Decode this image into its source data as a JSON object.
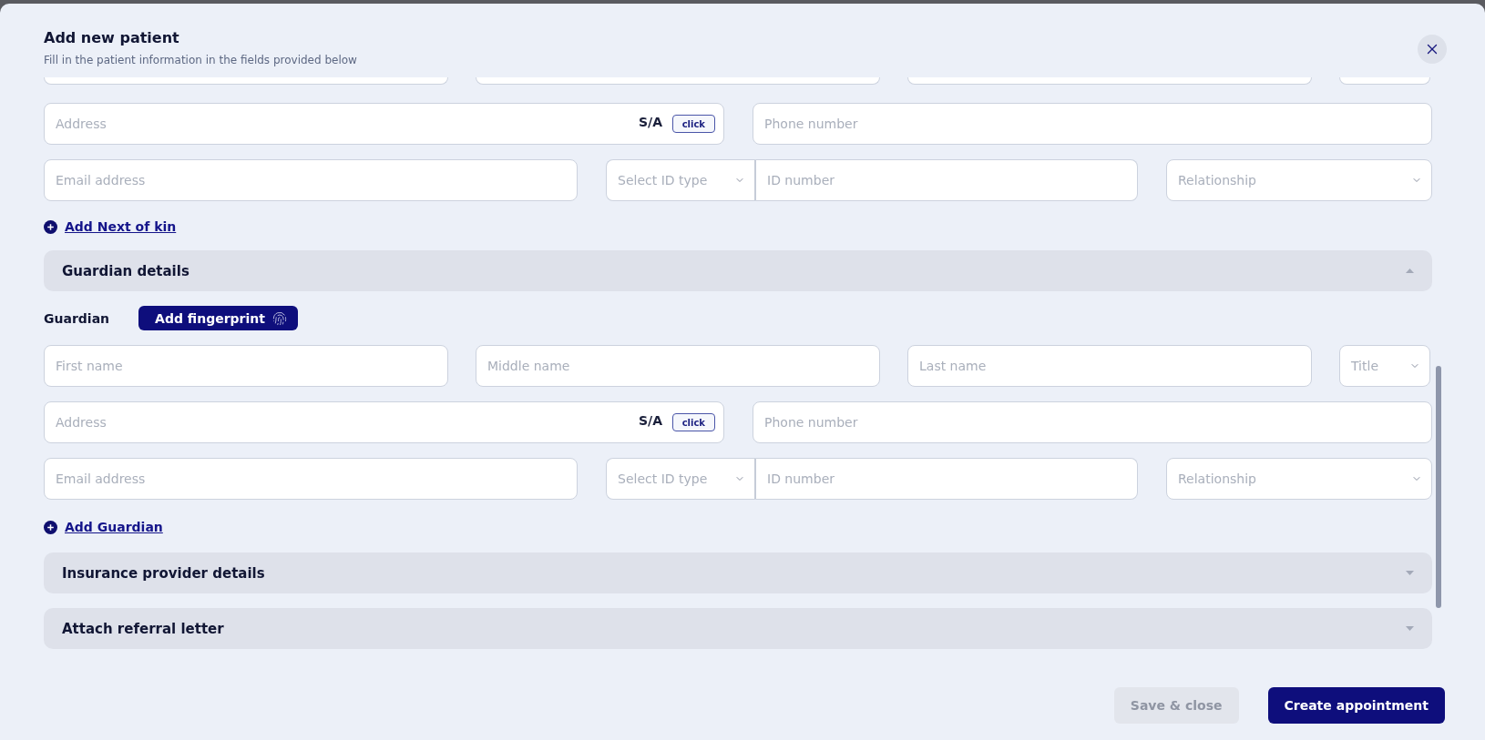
{
  "dialog": {
    "title": "Add new patient",
    "subtitle": "Fill in the patient information in the fields provided below"
  },
  "next_of_kin": {
    "address": {
      "placeholder": "Address"
    },
    "sa_label": "S/A",
    "sa_button": "click",
    "phone": {
      "placeholder": "Phone number"
    },
    "email": {
      "placeholder": "Email address"
    },
    "id_type": {
      "placeholder": "Select ID type"
    },
    "id_number": {
      "placeholder": "ID number"
    },
    "relationship": {
      "placeholder": "Relationship"
    },
    "add_link": "Add Next of kin"
  },
  "sections": [
    {
      "title": "Guardian details",
      "expanded": true,
      "person_label": "Guardian",
      "fingerprint_button": "Add fingerprint",
      "first_name": {
        "placeholder": "First name"
      },
      "middle_name": {
        "placeholder": "Middle name"
      },
      "last_name": {
        "placeholder": "Last name"
      },
      "title_select": {
        "placeholder": "Title"
      },
      "address": {
        "placeholder": "Address"
      },
      "sa_label": "S/A",
      "sa_button": "click",
      "phone": {
        "placeholder": "Phone number"
      },
      "email": {
        "placeholder": "Email address"
      },
      "id_type": {
        "placeholder": "Select ID type"
      },
      "id_number": {
        "placeholder": "ID number"
      },
      "relationship": {
        "placeholder": "Relationship"
      },
      "add_link": "Add Guardian"
    },
    {
      "title": "Insurance provider details",
      "expanded": false
    },
    {
      "title": "Attach referral letter",
      "expanded": false
    }
  ],
  "footer": {
    "buttons": [
      {
        "label": "Save & close",
        "disabled": true
      },
      {
        "label": "Create appointment",
        "disabled": false
      }
    ]
  }
}
